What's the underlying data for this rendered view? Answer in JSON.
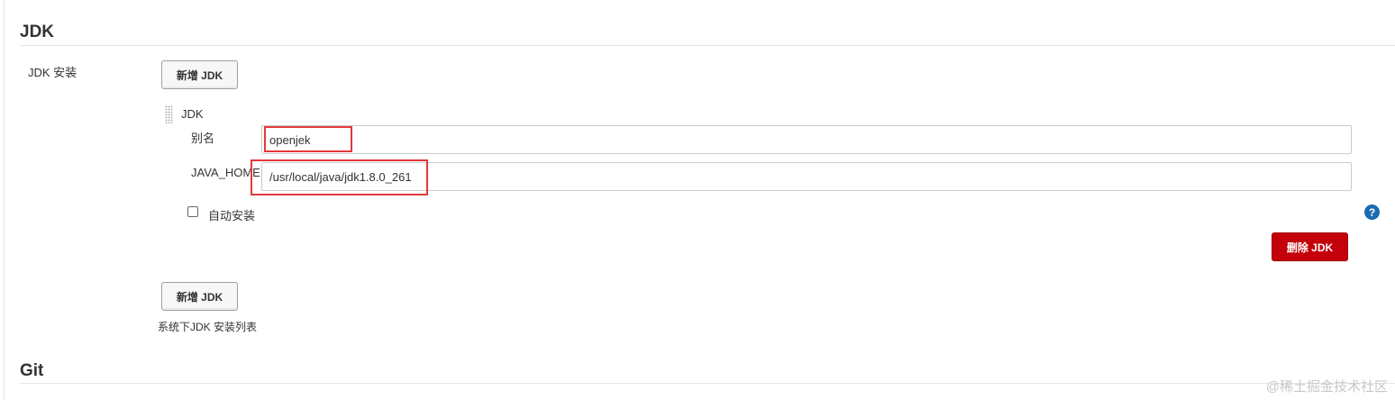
{
  "jdk_section": {
    "title": "JDK",
    "install_label": "JDK 安装",
    "add_button_label": "新增 JDK",
    "jdk_block": {
      "header": "JDK",
      "alias_label": "别名",
      "alias_value": "openjek",
      "java_home_label": "JAVA_HOME",
      "java_home_value": "/usr/local/java/jdk1.8.0_261",
      "auto_install_label": "自动安装",
      "auto_install_checked": false,
      "delete_button_label": "删除 JDK",
      "help_icon_glyph": "?"
    },
    "add_button_label_bottom": "新增 JDK",
    "list_caption": "系统下JDK 安装列表"
  },
  "git_section": {
    "title": "Git"
  },
  "watermark": "@稀土掘金技术社区",
  "colors": {
    "danger": "#c4000a",
    "highlight": "#e23a3a",
    "help": "#1a6bb0"
  }
}
